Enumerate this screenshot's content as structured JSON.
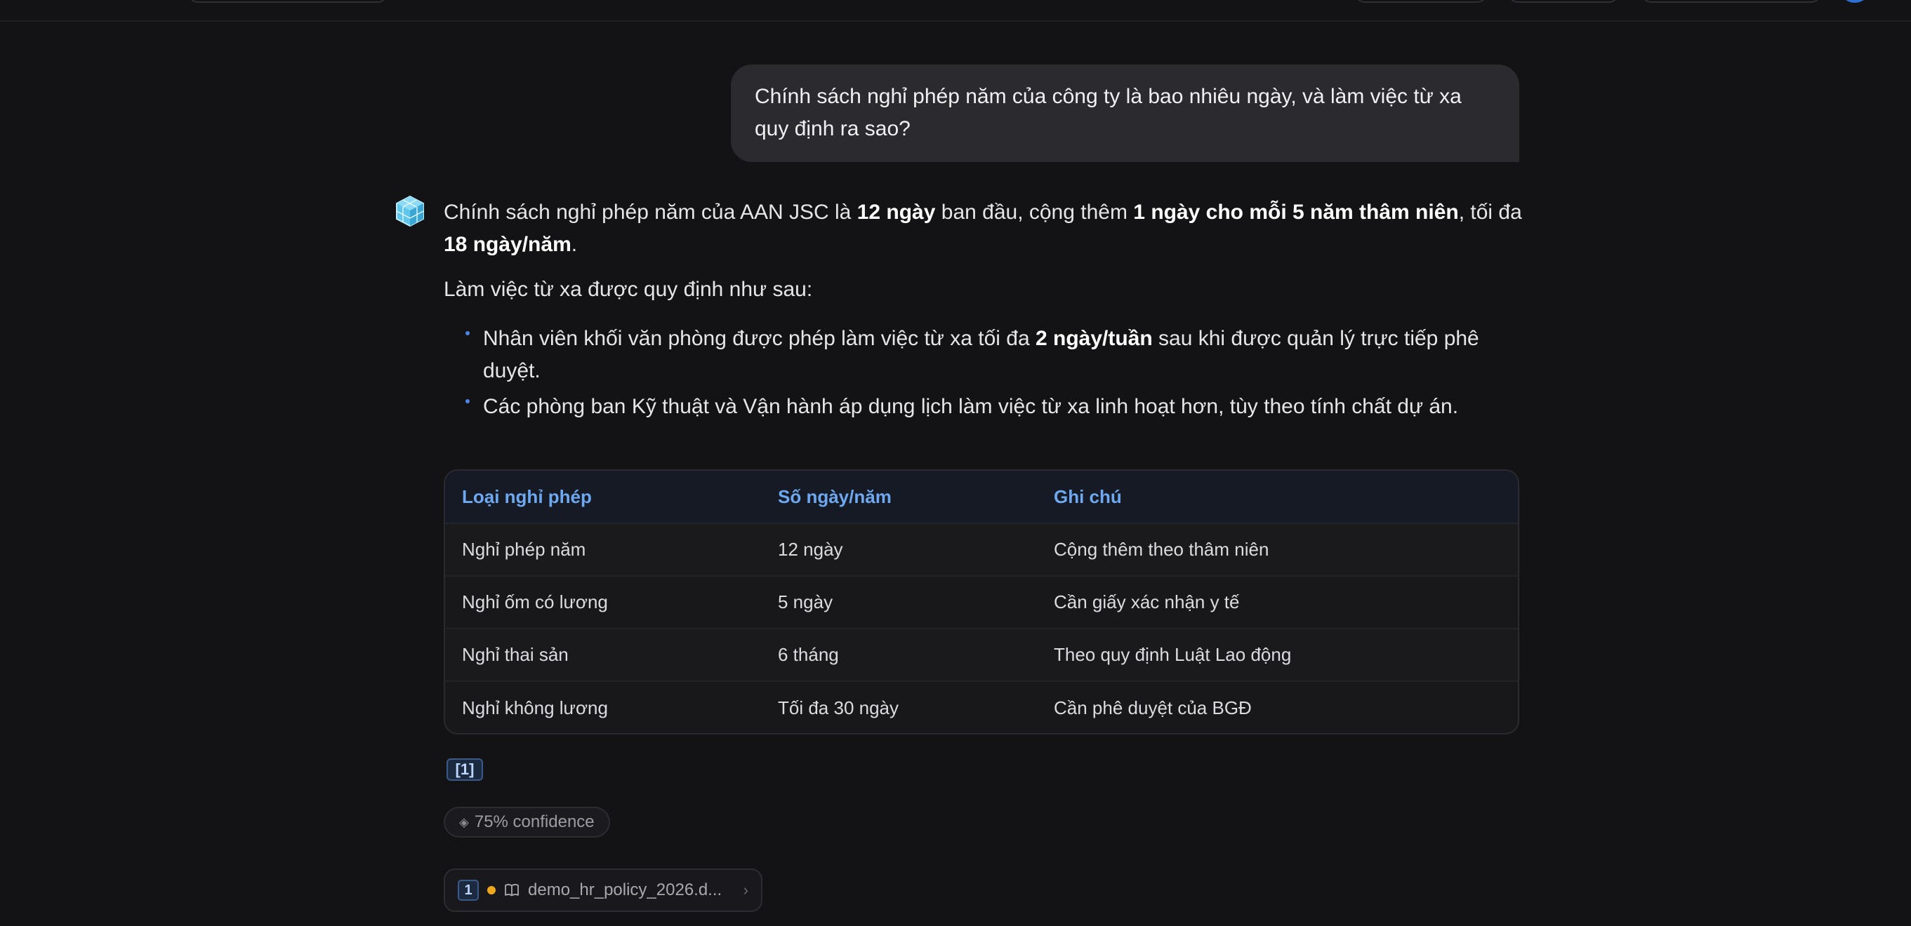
{
  "user_message": "Chính sách nghỉ phép năm của công ty là bao nhiêu ngày, và làm việc từ xa quy định ra sao?",
  "answer": {
    "p1": {
      "t1": "Chính sách nghỉ phép năm của AAN JSC là ",
      "b1": "12 ngày",
      "t2": " ban đầu, cộng thêm ",
      "b2": "1 ngày cho mỗi 5 năm thâm niên",
      "t3": ", tối đa ",
      "b3": "18 ngày/năm",
      "t4": "."
    },
    "p2": "Làm việc từ xa được quy định như sau:",
    "bullet1": {
      "t1": "Nhân viên khối văn phòng được phép làm việc từ xa tối đa ",
      "b1": "2 ngày/tuần",
      "t2": " sau khi được quản lý trực tiếp phê duyệt."
    },
    "bullet2": "Các phòng ban Kỹ thuật và Vận hành áp dụng lịch làm việc từ xa linh hoạt hơn, tùy theo tính chất dự án."
  },
  "table": {
    "headers": [
      "Loại nghỉ phép",
      "Số ngày/năm",
      "Ghi chú"
    ],
    "rows": [
      [
        "Nghỉ phép năm",
        "12 ngày",
        "Cộng thêm theo thâm niên"
      ],
      [
        "Nghỉ ốm có lương",
        "5 ngày",
        "Cần giấy xác nhận y tế"
      ],
      [
        "Nghỉ thai sản",
        "6 tháng",
        "Theo quy định Luật Lao động"
      ],
      [
        "Nghỉ không lương",
        "Tối đa 30 ngày",
        "Cần phê duyệt của BGĐ"
      ]
    ]
  },
  "citation": "[1]",
  "confidence": "75% confidence",
  "source": {
    "number": "1",
    "name": "demo_hr_policy_2026.d...",
    "status_color": "#f0a91c"
  },
  "colors": {
    "accent": "#4c86e8",
    "header_text": "#6ea8f0",
    "background": "#131316"
  }
}
